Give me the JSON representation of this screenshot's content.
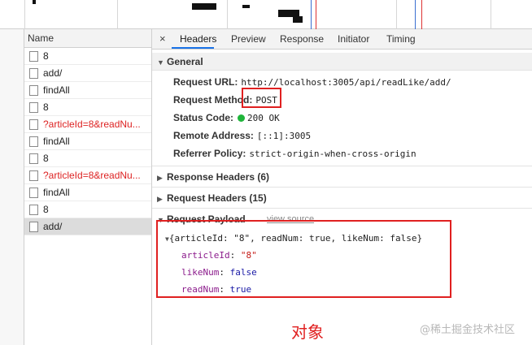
{
  "request_list": {
    "header": "Name",
    "items": [
      {
        "label": "8",
        "error": false,
        "selected": false
      },
      {
        "label": "add/",
        "error": false,
        "selected": false
      },
      {
        "label": "findAll",
        "error": false,
        "selected": false
      },
      {
        "label": "8",
        "error": false,
        "selected": false
      },
      {
        "label": "?articleId=8&readNu...",
        "error": true,
        "selected": false
      },
      {
        "label": "findAll",
        "error": false,
        "selected": false
      },
      {
        "label": "8",
        "error": false,
        "selected": false
      },
      {
        "label": "?articleId=8&readNu...",
        "error": true,
        "selected": false
      },
      {
        "label": "findAll",
        "error": false,
        "selected": false
      },
      {
        "label": "8",
        "error": false,
        "selected": false
      },
      {
        "label": "add/",
        "error": false,
        "selected": true
      }
    ]
  },
  "tabs": {
    "close": "×",
    "items": [
      "Headers",
      "Preview",
      "Response",
      "Initiator",
      "Timing"
    ],
    "active": "Headers"
  },
  "general": {
    "title": "General",
    "request_url_label": "Request URL:",
    "request_url": "http://localhost:3005/api/readLike/add/",
    "request_method_label": "Request Method:",
    "request_method": "POST",
    "status_code_label": "Status Code:",
    "status_code": "200 OK",
    "status_color": "#1fb53a",
    "remote_address_label": "Remote Address:",
    "remote_address": "[::1]:3005",
    "referrer_policy_label": "Referrer Policy:",
    "referrer_policy": "strict-origin-when-cross-origin"
  },
  "sections": {
    "response_headers": "Response Headers (6)",
    "request_headers": "Request Headers (15)",
    "request_payload": "Request Payload",
    "view_source": "view source"
  },
  "payload": {
    "summary_open": "{articleId: \"8\", readNum: true, likeNum: false}",
    "fields": [
      {
        "key": "articleId",
        "value": "\"8\"",
        "kind": "str"
      },
      {
        "key": "likeNum",
        "value": "false",
        "kind": "kw"
      },
      {
        "key": "readNum",
        "value": "true",
        "kind": "kw"
      }
    ]
  },
  "annotation": {
    "label": "对象",
    "color": "#e02020"
  },
  "watermark": "@稀土掘金技术社区"
}
